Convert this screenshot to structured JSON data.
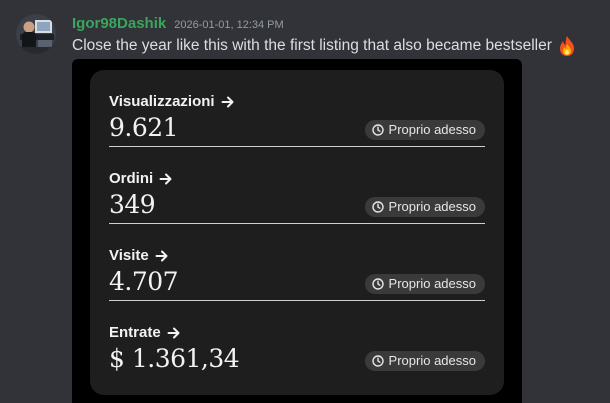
{
  "message": {
    "username": "Igor98Dashik",
    "timestamp": "2026-01-01, 12:34 PM",
    "text": "Close the year like this with the first listing that also became bestseller",
    "emoji_icon": "fire-emoji",
    "username_color": "#3ba55c"
  },
  "stats_card": {
    "metrics": [
      {
        "label": "Visualizzazioni",
        "value": "9.621",
        "badge": "Proprio adesso"
      },
      {
        "label": "Ordini",
        "value": "349",
        "badge": "Proprio adesso"
      },
      {
        "label": "Visite",
        "value": "4.707",
        "badge": "Proprio adesso"
      },
      {
        "label": "Entrate",
        "value": "$ 1.361,34",
        "badge": "Proprio adesso"
      }
    ]
  }
}
